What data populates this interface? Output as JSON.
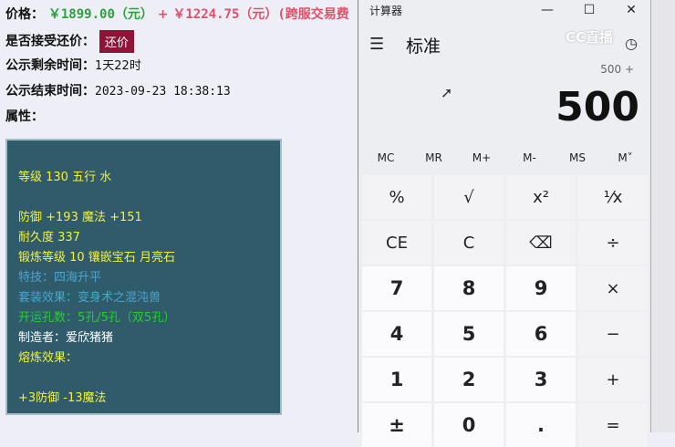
{
  "listing": {
    "price_label": "价格：",
    "price_main": "￥1899.00（元）",
    "plus": "+",
    "price_fee": "￥1224.75（元）(跨服交易费",
    "bargain_label": "是否接受还价：",
    "bargain_button": "还价",
    "remain_label": "公示剩余时间：",
    "remain_value": "1天22时",
    "end_label": "公示结束时间：",
    "end_value": "2023-09-23 18:38:13",
    "attr_label": "属性："
  },
  "attributes": [
    {
      "text": "等级 130 五行 水",
      "color": "y"
    },
    {
      "text": "",
      "color": "y"
    },
    {
      "text": "防御 +193 魔法 +151",
      "color": "y"
    },
    {
      "text": "耐久度 337",
      "color": "y"
    },
    {
      "text": "锻炼等级 10 镶嵌宝石 月亮石",
      "color": "y"
    },
    {
      "text": "特技：四海升平",
      "color": "b"
    },
    {
      "text": "套装效果：变身术之混沌兽",
      "color": "b"
    },
    {
      "text": "开运孔数：5孔/5孔（双5孔）",
      "color": "g"
    },
    {
      "text": "制造者：爱欣猪猪",
      "color": "w"
    },
    {
      "text": "熔炼效果：",
      "color": "y"
    },
    {
      "text": "",
      "color": "y"
    },
    {
      "text": "+3防御 -13魔法",
      "color": "y"
    }
  ],
  "calculator": {
    "title": "计算器",
    "mode": "标准",
    "expression": "500 +",
    "display": "500",
    "memory": [
      "MC",
      "MR",
      "M+",
      "M-",
      "MS",
      "M˅"
    ],
    "keys": [
      [
        "%",
        "√",
        "x²",
        "¹⁄x"
      ],
      [
        "CE",
        "C",
        "⌫",
        "÷"
      ],
      [
        "7",
        "8",
        "9",
        "×"
      ],
      [
        "4",
        "5",
        "6",
        "−"
      ],
      [
        "1",
        "2",
        "3",
        "+"
      ],
      [
        "±",
        "0",
        ".",
        "="
      ]
    ]
  },
  "watermark": "CC直播"
}
